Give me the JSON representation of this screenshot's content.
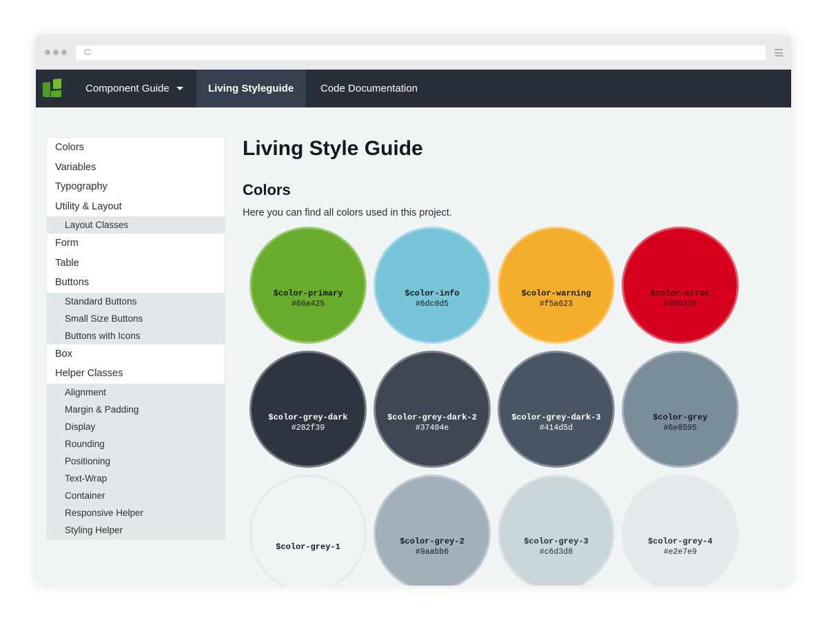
{
  "colors": {
    "navbar": "#282f39",
    "nav_active": "#37404e",
    "logo_green": "#60a425"
  },
  "nav": {
    "logo_icon": "leaf-logo-icon",
    "items": [
      {
        "label": "Component Guide"
      },
      {
        "label": "Living Styleguide"
      },
      {
        "label": "Code Documentation"
      }
    ]
  },
  "sidebar": {
    "colors": "Colors",
    "variables": "Variables",
    "typography": "Typography",
    "utility": "Utility & Layout",
    "utility_sub": [
      "Layout Classes"
    ],
    "form": "Form",
    "table": "Table",
    "buttons": "Buttons",
    "buttons_sub": [
      "Standard Buttons",
      "Small Size Buttons",
      "Buttons with Icons"
    ],
    "box": "Box",
    "helper": "Helper Classes",
    "helper_sub": [
      "Alignment",
      "Margin & Padding",
      "Display",
      "Rounding",
      "Positioning",
      "Text-Wrap",
      "Container",
      "Responsive Helper",
      "Styling Helper"
    ]
  },
  "main": {
    "title": "Living Style Guide",
    "section_title": "Colors",
    "section_desc": "Here you can find all colors used in this project.",
    "swatches": [
      {
        "name": "$color-primary",
        "hex": "#60a425",
        "fill": "#6aad2c",
        "text": "#15191e"
      },
      {
        "name": "$color-info",
        "hex": "#6dc0d5",
        "fill": "#78c4d8",
        "text": "#15191e"
      },
      {
        "name": "$color-warning",
        "hex": "#f5a623",
        "fill": "#f5ae2b",
        "text": "#15191e"
      },
      {
        "name": "$color-error",
        "hex": "#d0021b",
        "fill": "#d4001d",
        "text": "#3d0006"
      },
      {
        "name": "$color-grey-dark",
        "hex": "#282f39",
        "fill": "#2f3540",
        "text": "#ffffff"
      },
      {
        "name": "$color-grey-dark-2",
        "hex": "#37404e",
        "fill": "#3e4654",
        "text": "#ffffff"
      },
      {
        "name": "$color-grey-dark-3",
        "hex": "#414d5d",
        "fill": "#4a5564",
        "text": "#ffffff"
      },
      {
        "name": "$color-grey",
        "hex": "#6e8595",
        "fill": "#7a8d9b",
        "text": "#15191e"
      },
      {
        "name": "$color-grey-1",
        "hex": "",
        "fill": "#f1f4f5",
        "text": "#15191e"
      },
      {
        "name": "$color-grey-2",
        "hex": "#9aabb6",
        "fill": "#a2b1bb",
        "text": "#15191e"
      },
      {
        "name": "$color-grey-3",
        "hex": "#c6d3d8",
        "fill": "#cbd6da",
        "text": "#282f39"
      },
      {
        "name": "$color-grey-4",
        "hex": "#e2e7e9",
        "fill": "#e4e9eb",
        "text": "#282f39"
      }
    ]
  }
}
